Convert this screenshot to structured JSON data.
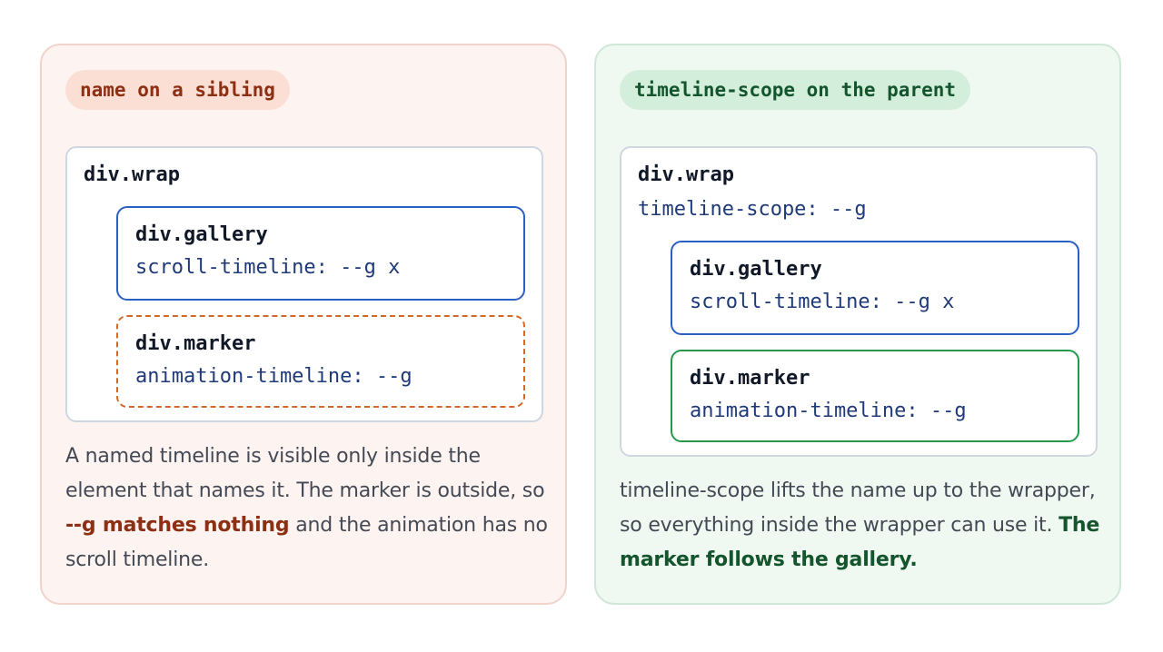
{
  "left_panel": {
    "pill": "name on a sibling",
    "wrap": {
      "name": "div.wrap"
    },
    "gallery": {
      "name": "div.gallery",
      "prop": "scroll-timeline: --g x"
    },
    "marker": {
      "name": "div.marker",
      "prop": "animation-timeline: --g"
    },
    "description": {
      "part1": "A named timeline is visible only inside the element that names it. The marker is outside, so ",
      "emphasis": "--g matches nothing",
      "part2": " and the animation has no scroll timeline."
    }
  },
  "right_panel": {
    "pill": "timeline-scope on the parent",
    "wrap": {
      "name": "div.wrap",
      "prop": "timeline-scope: --g"
    },
    "gallery": {
      "name": "div.gallery",
      "prop": "scroll-timeline: --g x"
    },
    "marker": {
      "name": "div.marker",
      "prop": "animation-timeline: --g"
    },
    "description": {
      "part1": "timeline-scope lifts the name up to the wrapper, so everything inside the wrapper can use it. ",
      "emphasis": "The marker follows the gallery."
    }
  },
  "colors": {
    "left_accent": "#8c2f12",
    "right_accent": "#14552d",
    "gallery_border": "#2b5fc2",
    "marker_broken_border": "#d2692a",
    "marker_working_border": "#239a4b"
  }
}
